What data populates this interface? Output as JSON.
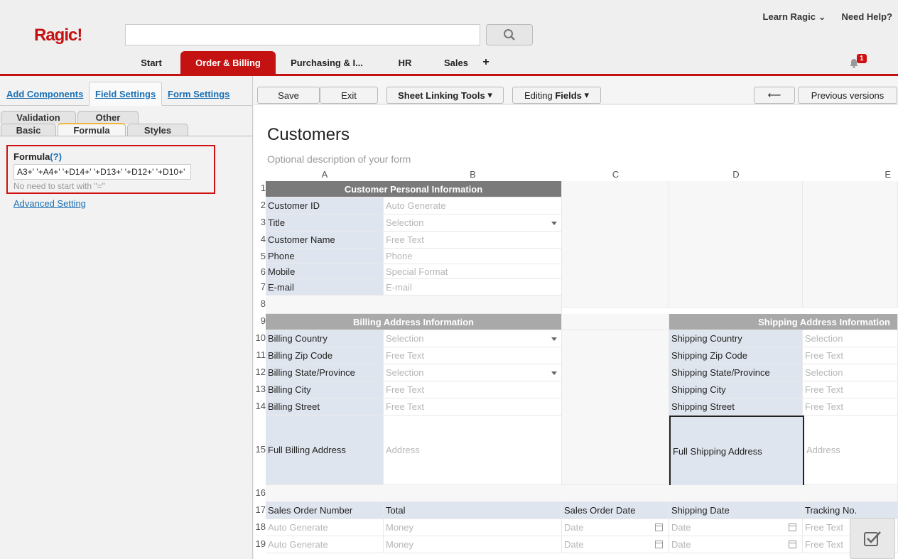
{
  "header": {
    "logo": "Ragic!",
    "search_placeholder": "",
    "learn": "Learn Ragic",
    "help": "Need Help?",
    "notifications": "1",
    "tabs": [
      "Start",
      "Order & Billing",
      "Purchasing & I...",
      "HR",
      "Sales",
      "+"
    ]
  },
  "left_panel": {
    "tabs": [
      "Add Components",
      "Field Settings",
      "Form Settings"
    ],
    "sub_tabs_top": [
      "Validation",
      "Other"
    ],
    "sub_tabs_bottom": [
      "Basic",
      "Formula",
      "Styles"
    ],
    "formula_label": "Formula",
    "formula_help": "(?)",
    "formula_value": "A3+' '+A4+' '+D14+' '+D13+' '+D12+' '+D10+'",
    "formula_hint": "No need to start with \"=\"",
    "advanced": "Advanced Setting"
  },
  "toolbar": {
    "save": "Save",
    "exit": "Exit",
    "sheet_linking": "Sheet Linking Tools",
    "editing_prefix": "Editing ",
    "editing_bold": "Fields",
    "back_arrow": "⟵",
    "previous_versions": "Previous versions"
  },
  "sheet": {
    "title": "Customers",
    "description": "Optional description of your form",
    "columns": [
      "A",
      "B",
      "C",
      "D",
      "E"
    ],
    "rows": [
      "1",
      "2",
      "3",
      "4",
      "5",
      "6",
      "7",
      "8",
      "9",
      "10",
      "11",
      "12",
      "13",
      "14",
      "15",
      "16",
      "17",
      "18",
      "19"
    ],
    "section_customer": "Customer Personal Information",
    "section_billing": "Billing Address Information",
    "section_shipping": "Shipping Address Information",
    "fields": {
      "customer_id": "Customer ID",
      "auto_generate": "Auto Generate",
      "title": "Title",
      "selection": "Selection",
      "customer_name": "Customer Name",
      "free_text": "Free Text",
      "phone": "Phone",
      "phone_ph": "Phone",
      "mobile": "Mobile",
      "special_format": "Special Format",
      "email": "E-mail",
      "email_ph": "E-mail",
      "billing_country": "Billing Country",
      "billing_zip": "Billing Zip Code",
      "billing_state": "Billing State/Province",
      "billing_city": "Billing City",
      "billing_street": "Billing Street",
      "full_billing": "Full Billing Address",
      "address": "Address",
      "shipping_country": "Shipping Country",
      "shipping_zip": "Shipping Zip Code",
      "shipping_state": "Shipping State/Province",
      "shipping_city": "Shipping City",
      "shipping_street": "Shipping Street",
      "full_shipping": "Full Shipping Address",
      "sales_order_number": "Sales Order Number",
      "total": "Total",
      "sales_order_date": "Sales Order Date",
      "shipping_date": "Shipping Date",
      "tracking_no": "Tracking No.",
      "money": "Money",
      "date": "Date"
    }
  }
}
